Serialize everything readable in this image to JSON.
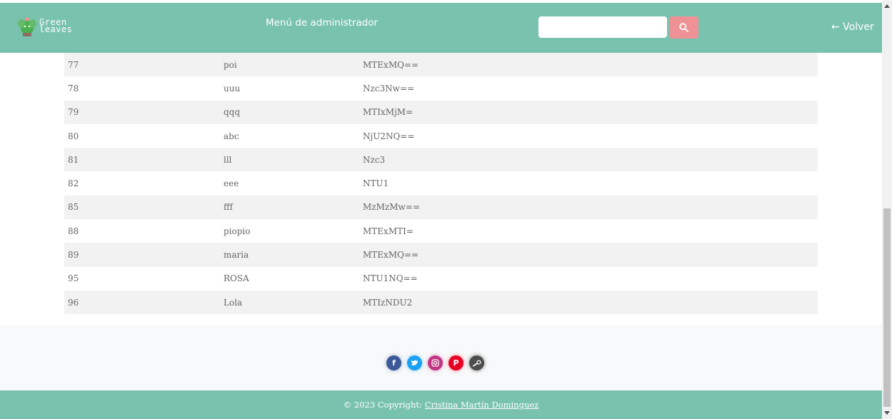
{
  "header": {
    "logo_text": "Green\nleaves",
    "title": "Menú de administrador",
    "search_placeholder": "",
    "search_icon": "search-icon",
    "back_label": "← Volver",
    "background_color": "#79c3ae",
    "search_button_color": "#ef9296"
  },
  "table": {
    "rows": [
      {
        "id": "77",
        "name": "poi",
        "password": "MTExMQ=="
      },
      {
        "id": "78",
        "name": "uuu",
        "password": "Nzc3Nw=="
      },
      {
        "id": "79",
        "name": "qqq",
        "password": "MTIxMjM="
      },
      {
        "id": "80",
        "name": "abc",
        "password": "NjU2NQ=="
      },
      {
        "id": "81",
        "name": "lll",
        "password": "Nzc3"
      },
      {
        "id": "82",
        "name": "eee",
        "password": "NTU1"
      },
      {
        "id": "85",
        "name": "fff",
        "password": "MzMzMw=="
      },
      {
        "id": "88",
        "name": "piopio",
        "password": "MTExMTI="
      },
      {
        "id": "89",
        "name": "maria",
        "password": "MTExMQ=="
      },
      {
        "id": "95",
        "name": "ROSA",
        "password": "NTU1NQ=="
      },
      {
        "id": "96",
        "name": "Lola",
        "password": "MTIzNDU2"
      }
    ]
  },
  "footer": {
    "social_icons": [
      "facebook-icon",
      "twitter-icon",
      "instagram-icon",
      "pinterest-icon",
      "steam-icon"
    ],
    "copyright_prefix": "© 2023 Copyright:",
    "copyright_author": "Cristina Martín Dominguez"
  }
}
